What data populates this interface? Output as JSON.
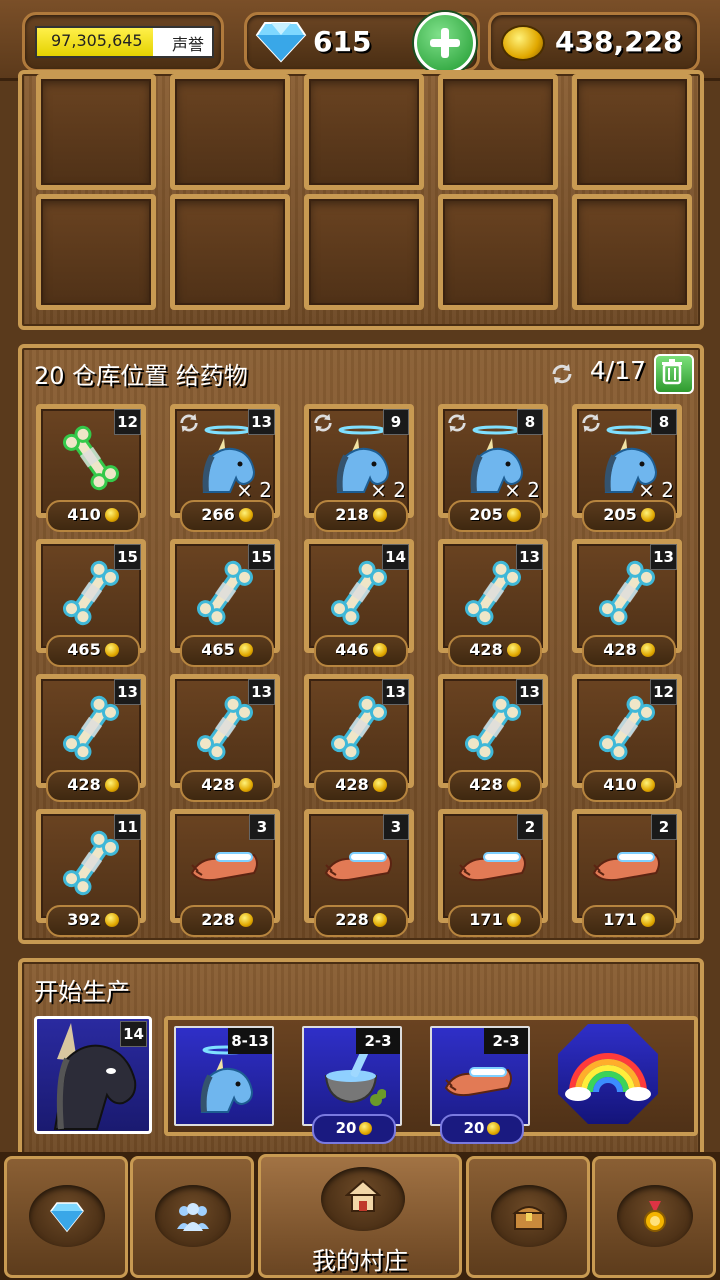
{
  "topbar": {
    "reputation_value": "97,305,645",
    "reputation_label": "声誉",
    "reputation_progress": 0.66,
    "gems": "615",
    "coins": "438,228"
  },
  "shelf": {
    "title": "20 仓库位置 给药物",
    "count": "4/17",
    "items": [
      {
        "art": "bone-green",
        "level": "12",
        "price": "410"
      },
      {
        "art": "unicorn",
        "level": "13",
        "price": "266",
        "mult": "× 2",
        "refresh": true
      },
      {
        "art": "unicorn",
        "level": "9",
        "price": "218",
        "mult": "× 2",
        "refresh": true
      },
      {
        "art": "unicorn",
        "level": "8",
        "price": "205",
        "mult": "× 2",
        "refresh": true
      },
      {
        "art": "unicorn",
        "level": "8",
        "price": "205",
        "mult": "× 2",
        "refresh": true
      },
      {
        "art": "bone",
        "level": "15",
        "price": "465"
      },
      {
        "art": "bone",
        "level": "15",
        "price": "465"
      },
      {
        "art": "bone",
        "level": "14",
        "price": "446"
      },
      {
        "art": "bone",
        "level": "13",
        "price": "428"
      },
      {
        "art": "bone",
        "level": "13",
        "price": "428"
      },
      {
        "art": "bone",
        "level": "13",
        "price": "428"
      },
      {
        "art": "bone",
        "level": "13",
        "price": "428"
      },
      {
        "art": "bone",
        "level": "13",
        "price": "428"
      },
      {
        "art": "bone",
        "level": "13",
        "price": "428"
      },
      {
        "art": "bone",
        "level": "12",
        "price": "410"
      },
      {
        "art": "bone",
        "level": "11",
        "price": "392"
      },
      {
        "art": "arm",
        "level": "3",
        "price": "228"
      },
      {
        "art": "arm",
        "level": "3",
        "price": "228"
      },
      {
        "art": "arm",
        "level": "2",
        "price": "171"
      },
      {
        "art": "arm",
        "level": "2",
        "price": "171"
      }
    ]
  },
  "production": {
    "title": "开始生产",
    "unicorn_level": "14",
    "recipe": [
      {
        "art": "unicorn",
        "range": "8-13"
      },
      {
        "art": "mortar",
        "range": "2-3",
        "price": "20"
      },
      {
        "art": "arm",
        "range": "2-3",
        "price": "20"
      }
    ]
  },
  "nav": {
    "village_label": "我的村庄"
  },
  "colors": {
    "frame": "#c89a52",
    "wood": "#6a4321",
    "accent_green": "#2f9a2f",
    "coin": "#e1a800"
  }
}
